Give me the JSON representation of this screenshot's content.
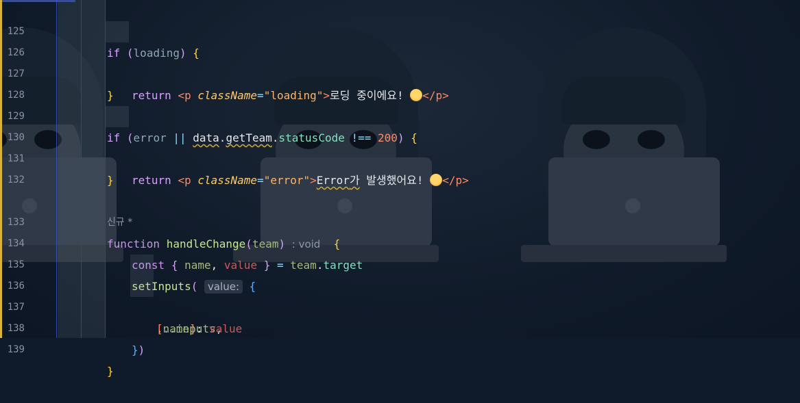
{
  "editor": {
    "lines": [
      {
        "no": "125"
      },
      {
        "no": "126"
      },
      {
        "no": "127"
      },
      {
        "no": "128"
      },
      {
        "no": "129"
      },
      {
        "no": "130"
      },
      {
        "no": "131"
      },
      {
        "no": "132"
      },
      {
        "no": ""
      },
      {
        "no": "133"
      },
      {
        "no": "134"
      },
      {
        "no": "135"
      },
      {
        "no": "136"
      },
      {
        "no": "137"
      },
      {
        "no": "138"
      },
      {
        "no": "139"
      }
    ],
    "t": {
      "if": "if",
      "loading": "loading",
      "return": "return",
      "p_open": "<p",
      "className": "className",
      "eq": "=",
      "loading_str": "\"loading\"",
      "gt": ">",
      "loading_text": "로딩 중이에요!",
      "p_close": "</p>",
      "error": "error",
      "or": "||",
      "data": "data",
      "dot": ".",
      "getTeam": "getTeam",
      "statusCode": "statusCode",
      "neq": "!==",
      "num200": "200",
      "error_str": "\"error\"",
      "error_word": "Error",
      "error_ga": "가",
      "error_rest": " 발생했어요!",
      "codelens": "신규 *",
      "function": "function",
      "handleChange": "handleChange",
      "team": "team",
      "void_hint": ": void",
      "const": "const",
      "name": "name",
      "comma": ",",
      "value": "value",
      "target": "target",
      "setInputs": "setInputs",
      "value_hint": "value:",
      "spread": "...",
      "inputs": "inputs",
      "colon": ":",
      "lb": "{",
      "rb": "}",
      "lp": "(",
      "rp": ")",
      "lsq": "[",
      "rsq": "]"
    }
  },
  "icons": {
    "emoji_1": "angry-face-emoji",
    "emoji_2": "shushing-face-emoji"
  },
  "colors": {
    "background": "#0f1b2a",
    "modified_bar": "#d9b23a",
    "keyword": "#d7a0ff",
    "string": "#ffb366",
    "function": "#c3e88d"
  }
}
